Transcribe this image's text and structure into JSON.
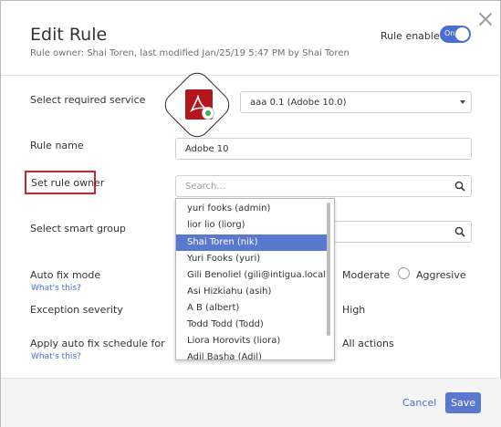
{
  "dialog": {
    "title": "Edit Rule",
    "subtitle": "Rule owner: Shai Toren, last modified Jan/25/19 5:47 PM by Shai Toren",
    "rule_enabled_label": "Rule enabled",
    "toggle_text": "On"
  },
  "form": {
    "service_label": "Select required service",
    "service_value": "aaa 0.1 (Adobe 10.0)",
    "rule_name_label": "Rule name",
    "rule_name_value": "Adobe 10",
    "owner_label": "Set rule owner",
    "owner_placeholder": "Search...",
    "smart_group_label": "Select smart group",
    "auto_fix_label": "Auto fix mode",
    "auto_fix_whats_this": "What's this?",
    "auto_fix_options": [
      "Moderate",
      "Aggresive"
    ],
    "exception_label": "Exception severity",
    "exception_value_visible": "High",
    "schedule_label": "Apply auto fix schedule for",
    "schedule_whats_this": "What's this?",
    "schedule_value_visible": "All actions"
  },
  "owner_dropdown": {
    "items": [
      "yuri fooks (admin)",
      "lior lio (liorg)",
      "Shai Toren (nik)",
      "Yuri Fooks (yuri)",
      "Gili Benoliel (gili@intigua.local)",
      "Asi Hizkiahu (asih)",
      "A B (albert)",
      "Todd Todd (Todd)",
      "Liora Horovits (liora)",
      "Adil Basha (Adil)"
    ],
    "selected_index": 2
  },
  "footer": {
    "cancel_label": "Cancel",
    "save_label": "Save"
  },
  "colors": {
    "accent": "#5b78d1",
    "highlight_border": "#d9202a",
    "adobe_red": "#b3161d",
    "status_green": "#3bb54a"
  },
  "icons": {
    "close": "close-icon",
    "service": "adobe-acrobat-icon",
    "search": "search-icon",
    "dropdown": "chevron-down-icon"
  }
}
